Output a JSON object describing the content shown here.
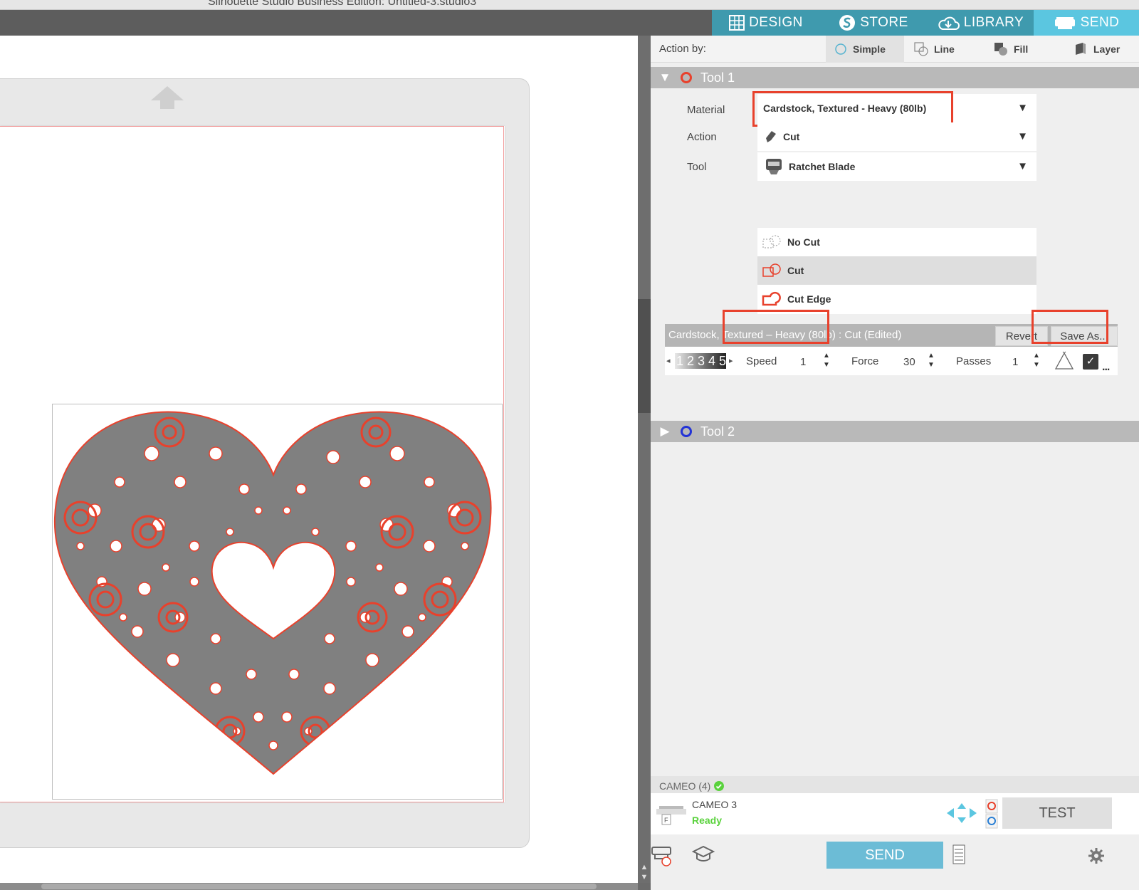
{
  "window": {
    "title": "Silhouette Studio Business Edition: Untitled-3.studio3"
  },
  "nav": {
    "design": "DESIGN",
    "store": "STORE",
    "library": "LIBRARY",
    "send": "SEND"
  },
  "action_by": {
    "label": "Action by:",
    "options": [
      "Simple",
      "Line",
      "Fill",
      "Layer"
    ],
    "selected": "Simple"
  },
  "tool1": {
    "name": "Tool 1",
    "material_label": "Material",
    "material": "Cardstock, Textured - Heavy (80lb)",
    "action_label": "Action",
    "action": "Cut",
    "tool_label": "Tool",
    "tool": "Ratchet Blade",
    "cut_options": [
      "No Cut",
      "Cut",
      "Cut Edge"
    ],
    "cut_selected": "Cut"
  },
  "settings": {
    "title": "Cardstock, Textured – Heavy (80lb) : Cut (Edited)",
    "revert": "Revert",
    "save_as": "Save As...",
    "blade_numbers": "12345",
    "speed_label": "Speed",
    "speed": "1",
    "force_label": "Force",
    "force": "30",
    "passes_label": "Passes",
    "passes": "1",
    "more": "..."
  },
  "tool2": {
    "name": "Tool 2"
  },
  "machine": {
    "header": "CAMEO (4)",
    "name": "CAMEO 3",
    "status": "Ready",
    "test": "TEST"
  },
  "send_button": "SEND",
  "colors": {
    "accent": "#3f9aae",
    "send_tab": "#5bc6e0",
    "tool1_ring": "#e8412c",
    "tool2_ring": "#2333d6",
    "highlight": "#e8412c",
    "status_ready": "#5ad23d",
    "heart_fill": "#808080",
    "cut_line": "#e8412c"
  },
  "icons": [
    "grid-icon",
    "silhouette-s-icon",
    "cloud-library-icon",
    "cutter-icon",
    "feed-arrow-icon",
    "settings-gear-icon",
    "tutorial-cap-icon"
  ]
}
